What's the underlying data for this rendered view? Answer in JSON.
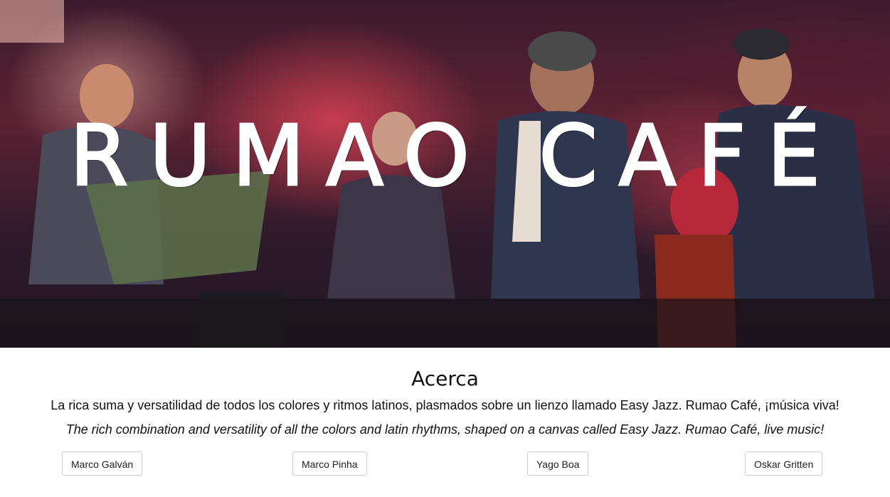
{
  "hero": {
    "title": "RUMAO CAFÉ"
  },
  "about": {
    "heading": "Acerca",
    "text_es": "La rica suma y versatilidad de todos los colores y ritmos latinos, plasmados sobre un lienzo llamado Easy Jazz. Rumao Café, ¡música viva!",
    "text_en": "The rich combination and versatility of all the colors and latin rhythms, shaped on a canvas called Easy Jazz. Rumao Café, live music!"
  },
  "members": [
    {
      "label": "Marco Galván"
    },
    {
      "label": "Marco Pinha"
    },
    {
      "label": "Yago Boa"
    },
    {
      "label": "Oskar Gritten"
    }
  ]
}
